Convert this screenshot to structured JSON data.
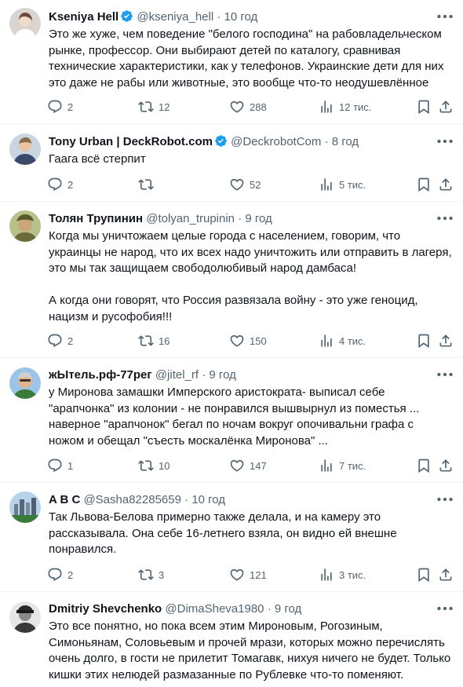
{
  "tweets": [
    {
      "name": "Kseniya Hell",
      "verified": true,
      "handle": "@kseniya_hell",
      "separator": "·",
      "time": "10 год",
      "text": "Это же хуже, чем поведение \"белого господина\" на рабовладельческом рынке, профессор. Они выбирают детей по каталогу, сравнивая технические характеристики, как у телефонов. Украинские дети для них это даже не рабы или животные, это вообще что-то неодушевлённое",
      "replies": "2",
      "retweets": "12",
      "likes": "288",
      "views": "12 тис."
    },
    {
      "name": "Tony Urban | DeckRobot.com",
      "verified": true,
      "handle": "@DeckrobotCom",
      "separator": "·",
      "time": "8 год",
      "text": "Гаага всё стерпит",
      "replies": "2",
      "retweets": "",
      "likes": "52",
      "views": "5 тис."
    },
    {
      "name": "Толян Трупинин",
      "verified": false,
      "handle": "@tolyan_trupinin",
      "separator": "·",
      "time": "9 год",
      "text": "Когда мы уничтожаем целые города с населением, говорим, что украинцы не народ, что их всех надо уничтожить или отправить в лагеря, это мы так защищаем свободолюбивый народ дамбаса!\n\nА когда они говорят, что Россия развязала войну - это уже геноцид, нацизм и русофобия!!!",
      "replies": "2",
      "retweets": "16",
      "likes": "150",
      "views": "4 тис."
    },
    {
      "name": "жЫтель.рф-77рег",
      "verified": false,
      "handle": "@jitel_rf",
      "separator": "·",
      "time": "9 год",
      "text": "у Миронова замашки Имперского аристократа- выписал себе \"арапчонка\" из колонии - не понравился вышвырнул из поместья ... наверное \"арапчонок\" бегал по ночам вокруг опочивальни графа с ножом и обещал \"съесть москалёнка Миронова\" ...",
      "replies": "1",
      "retweets": "10",
      "likes": "147",
      "views": "7 тис."
    },
    {
      "name": "A B C",
      "verified": false,
      "handle": "@Sasha82285659",
      "separator": "·",
      "time": "10 год",
      "text": "Так Львова-Белова примерно также делала, и на камеру это рассказывала. Она себе 16-летнего взяла, он видно ей внешне понравился.",
      "replies": "2",
      "retweets": "3",
      "likes": "121",
      "views": "3 тис."
    },
    {
      "name": "Dmitriy Shevchenko",
      "verified": false,
      "handle": "@DimaSheva1980",
      "separator": "·",
      "time": "9 год",
      "text": "Это все понятно, но пока всем этим Мироновым, Рогозиным, Симоньянам, Соловьевым и прочей мрази, которых можно перечислять очень долго, в гости не прилетит Томагавк, нихуя ничего не будет. Только кишки этих нелюдей размазанные по Рублевке что-то поменяют.",
      "replies": "",
      "retweets": "",
      "likes": "",
      "views": ""
    }
  ],
  "colors": {
    "text": "#0f1419",
    "secondary": "#536471",
    "verified": "#1d9bf0",
    "divider": "#eff3f4"
  }
}
